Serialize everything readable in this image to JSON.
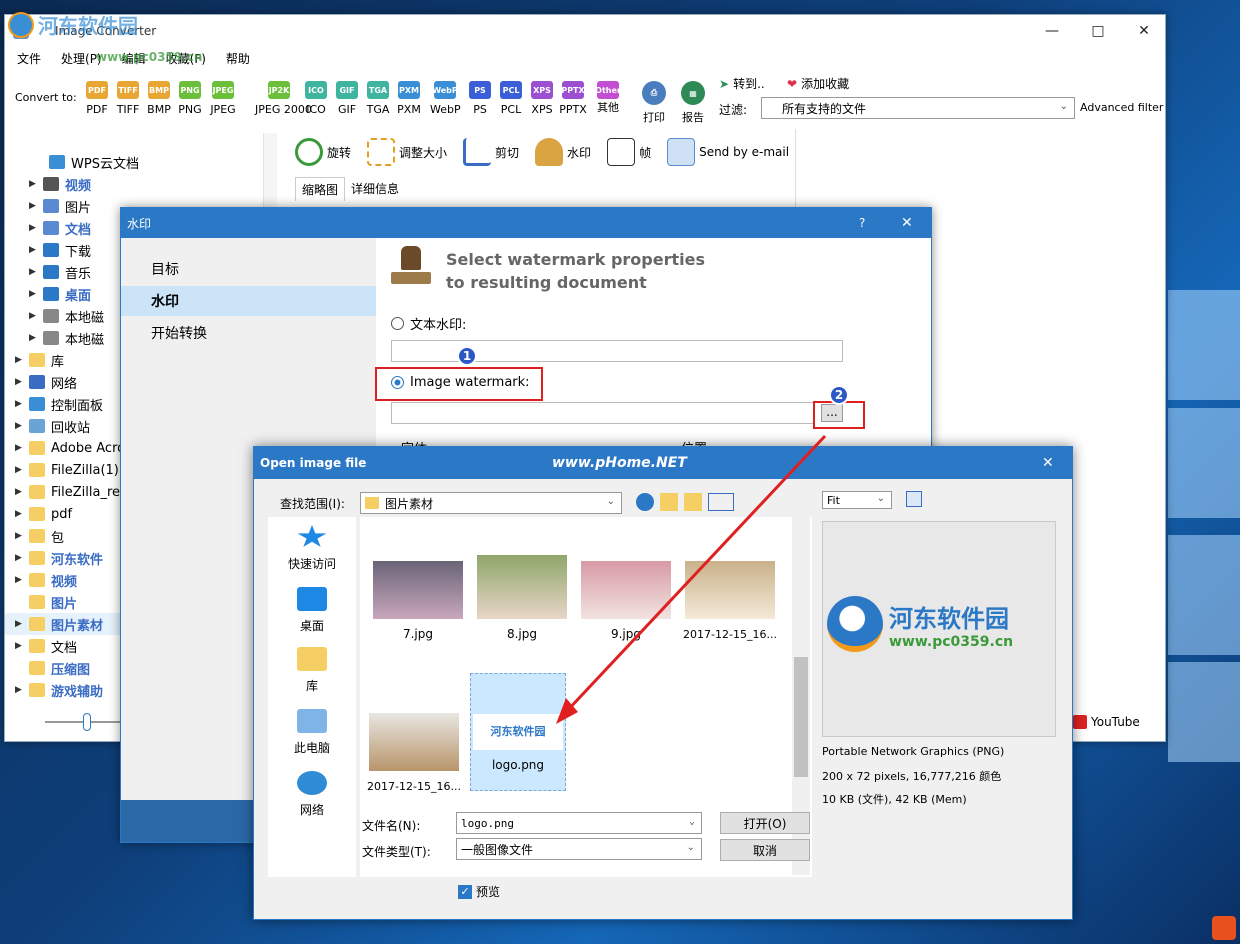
{
  "main_window": {
    "title": "Image Converter",
    "menu": [
      "文件",
      "处理(P)",
      "编辑",
      "收藏(F)",
      "帮助"
    ],
    "convert_to_label": "Convert to:",
    "formats": [
      "PDF",
      "TIFF",
      "BMP",
      "PNG",
      "JPEG",
      "JPEG 2000",
      "ICO",
      "GIF",
      "TGA",
      "PXM",
      "WebP",
      "PS",
      "PCL",
      "XPS",
      "PPTX",
      "其他"
    ],
    "format_icons": [
      "PDF",
      "TIFF",
      "BMP",
      "PNG",
      "JPEG",
      "JP2K",
      "ICO",
      "GIF",
      "TGA",
      "PXM",
      "WebP",
      "PS",
      "PCL",
      "XPS",
      "PPTX",
      "Other"
    ],
    "print_label": "打印",
    "report_label": "报告",
    "goto_label": "转到..",
    "favorite_label": "添加收藏",
    "filter_label": "过滤:",
    "filter_value": "所有支持的文件",
    "advanced_filter": "Advanced filter",
    "actions": [
      "旋转",
      "调整大小",
      "剪切",
      "水印",
      "帧",
      "Send by e-mail"
    ],
    "tabs": [
      "缩略图",
      "详细信息"
    ],
    "youtube": "YouTube"
  },
  "tree": [
    {
      "label": "WPS云文档",
      "bold": false
    },
    {
      "label": "视频",
      "bold": true
    },
    {
      "label": "图片",
      "bold": false
    },
    {
      "label": "文档",
      "bold": true
    },
    {
      "label": "下载",
      "bold": false
    },
    {
      "label": "音乐",
      "bold": false
    },
    {
      "label": "桌面",
      "bold": true
    },
    {
      "label": "本地磁",
      "bold": false
    },
    {
      "label": "本地磁",
      "bold": false
    },
    {
      "label": "库",
      "bold": false
    },
    {
      "label": "网络",
      "bold": false
    },
    {
      "label": "控制面板",
      "bold": false
    },
    {
      "label": "回收站",
      "bold": false
    },
    {
      "label": "Adobe Acro",
      "bold": false
    },
    {
      "label": "FileZilla(1)",
      "bold": false
    },
    {
      "label": "FileZilla_re",
      "bold": false
    },
    {
      "label": "pdf",
      "bold": false
    },
    {
      "label": "包",
      "bold": false
    },
    {
      "label": "河东软件",
      "bold": true
    },
    {
      "label": "视频",
      "bold": true
    },
    {
      "label": "图片",
      "bold": true
    },
    {
      "label": "图片素材",
      "bold": true
    },
    {
      "label": "文档",
      "bold": false
    },
    {
      "label": "压缩图",
      "bold": true
    },
    {
      "label": "游戏辅助",
      "bold": true
    }
  ],
  "watermark_dialog": {
    "title": "水印",
    "help": "?",
    "nav": [
      "目标",
      "水印",
      "开始转换"
    ],
    "heading_line1": "Select watermark properties",
    "heading_line2": "to resulting document",
    "text_watermark": "文本水印:",
    "image_watermark": "Image watermark:",
    "browse": "...",
    "font_label": "字体",
    "position_label": "位置",
    "marker1": "1",
    "marker2": "2"
  },
  "open_dialog": {
    "title": "Open image file",
    "watermark_text": "www.pHome.NET",
    "lookin_label": "查找范围(I):",
    "lookin_value": "图片素材",
    "places": [
      "快速访问",
      "桌面",
      "库",
      "此电脑",
      "网络"
    ],
    "files": [
      "7.jpg",
      "8.jpg",
      "9.jpg",
      "2017-12-15_16...",
      "2017-12-15_16...",
      "logo.png"
    ],
    "filename_label": "文件名(N):",
    "filename_value": "logo.png",
    "filetype_label": "文件类型(T):",
    "filetype_value": "一般图像文件",
    "open_button": "打开(O)",
    "cancel_button": "取消",
    "preview_checkbox": "预览",
    "fit_value": "Fit",
    "info_type": "Portable Network Graphics (PNG)",
    "info_size": "200 x 72 pixels, 16,777,216 颜色",
    "info_mem": "10 KB (文件), 42 KB (Mem)",
    "logo_title": "河东软件园",
    "logo_url": "www.pc0359.cn"
  },
  "overlay": {
    "site_title": "河东软件园",
    "site_url": "www.pc0359.cn"
  },
  "colors": {
    "accent": "#2b78c6",
    "highlight": "#e02020"
  }
}
